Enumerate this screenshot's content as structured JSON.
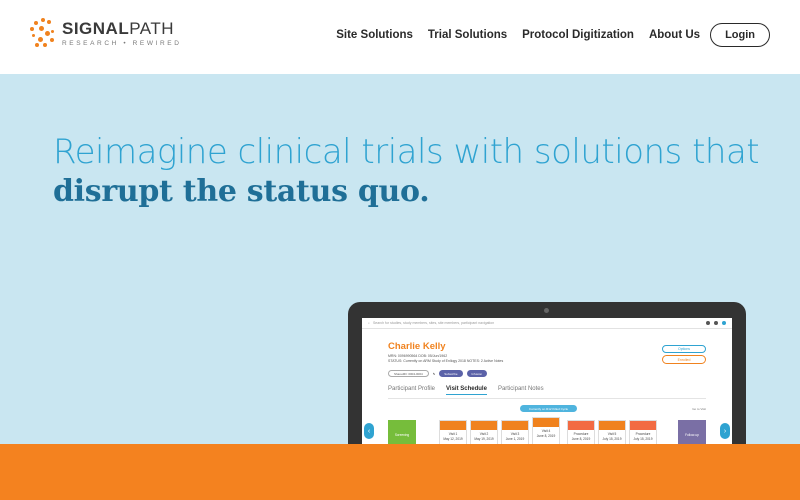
{
  "brand": {
    "name_bold": "SIGNAL",
    "name_light": "PATH",
    "tagline": "RESEARCH • REWIRED",
    "accent": "#f0821e"
  },
  "nav": {
    "items": [
      {
        "label": "Site Solutions"
      },
      {
        "label": "Trial Solutions"
      },
      {
        "label": "Protocol Digitization"
      },
      {
        "label": "About Us"
      }
    ],
    "login_label": "Login"
  },
  "hero": {
    "line1": "Reimagine clinical trials with solutions that",
    "line2": "disrupt the status quo.",
    "background": "#c9e6f1",
    "line1_color": "#2fa3d1",
    "line2_color": "#1f6f97"
  },
  "mock": {
    "search_placeholder": "Search for studies, study members, sites, site members, participant navigation",
    "participant_name": "Charlie Kelly",
    "meta_line1": "MRN: 0096990564      DOB: 05/Jun/1962",
    "meta_line2": "STATUS: Currently on ARM Study of Enllogy 2018      NOTES: 2 Active Notes",
    "options_label": "Options",
    "enroll_label": "Enrolled",
    "pill_outline": "SharedID: 0004-0004",
    "pill_1": "Subscribe",
    "pill_2": "Infusion",
    "tabs": [
      "Participant Profile",
      "Visit Schedule",
      "Participant Notes"
    ],
    "active_tab": 1,
    "banner": "Currently on R12 Killed Cycle",
    "view_label": "Go to Visit",
    "cards": [
      {
        "label": "Screening"
      },
      {
        "label": "Visit 1",
        "date": "May 12, 2019"
      },
      {
        "label": "Visit 2",
        "date": "May 19, 2019"
      },
      {
        "label": "Visit 3",
        "date": "June 1, 2019"
      },
      {
        "label": "Visit 4",
        "date": "June 8, 2019"
      },
      {
        "label": "Procedure",
        "date": "June 8, 2019"
      },
      {
        "label": "Visit 5",
        "date": "July 15, 2019"
      },
      {
        "label": "Procedure",
        "date": "July 15, 2019"
      },
      {
        "label": "Follow-up"
      }
    ]
  },
  "band_color": "#f4821f"
}
